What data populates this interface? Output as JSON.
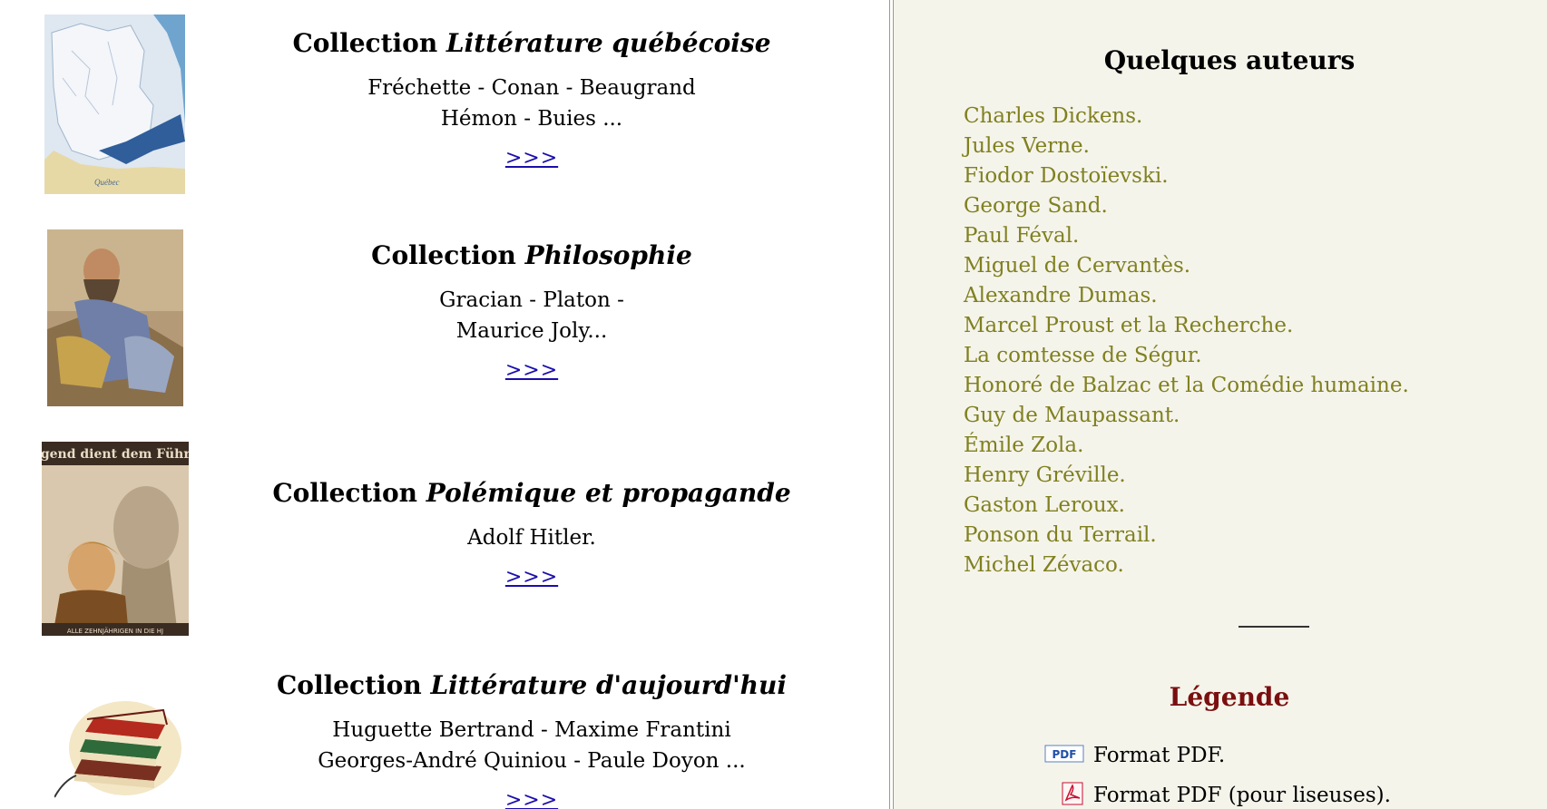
{
  "collections": [
    {
      "prefix": "Collection ",
      "title_italic": "Littérature québécoise",
      "authors_line1": "Fréchette - Conan - Beaugrand",
      "authors_line2": "Hémon - Buies ...",
      "link": ">>>",
      "thumb": "quebec-map-image"
    },
    {
      "prefix": "Collection ",
      "title_italic": "Philosophie",
      "authors_line1": "Gracian - Platon -",
      "authors_line2": "Maurice Joly...",
      "link": ">>>",
      "thumb": "philosopher-painting-image"
    },
    {
      "prefix": "Collection ",
      "title_italic": "Polémique et propagande",
      "authors_line1": "Adolf Hitler.",
      "authors_line2": "",
      "link": ">>>",
      "thumb": "propaganda-poster-image",
      "poster_top_text": "Jugend dient dem Führer",
      "poster_bottom_text": "ALLE ZEHNJÄHRIGEN IN DIE HJ"
    },
    {
      "prefix": "Collection ",
      "title_italic": "Littérature d'aujourd'hui",
      "authors_line1": "Huguette Bertrand - Maxime Frantini",
      "authors_line2": "Georges-André Quiniou - Paule Doyon ...",
      "link": ">>>",
      "thumb": "book-stack-image"
    }
  ],
  "sidebar": {
    "authors_title": "Quelques auteurs",
    "authors": [
      "Charles Dickens.",
      "Jules Verne.",
      "Fiodor Dostoïevski.",
      "George Sand.",
      "Paul Féval.",
      "Miguel de Cervantès.",
      "Alexandre Dumas.",
      "Marcel Proust et la Recherche.",
      "La comtesse de Ségur.",
      "Honoré de Balzac et la Comédie humaine.",
      "Guy de Maupassant.",
      "Émile Zola.",
      "Henry Gréville.",
      "Gaston Leroux.",
      "Ponson du Terrail.",
      "Michel Zévaco."
    ],
    "legend_title": "Légende",
    "legend": [
      {
        "icon": "pdf-icon",
        "icon_text": "PDF",
        "label": "Format PDF."
      },
      {
        "icon": "adobe-pdf-icon",
        "label": "Format PDF (pour liseuses)."
      }
    ]
  },
  "colors": {
    "left_bg": "#ffffff",
    "right_bg": "#f5f4eb",
    "author_link": "#808020",
    "legend_title": "#7a0f0f",
    "link": "#1a0dab"
  }
}
